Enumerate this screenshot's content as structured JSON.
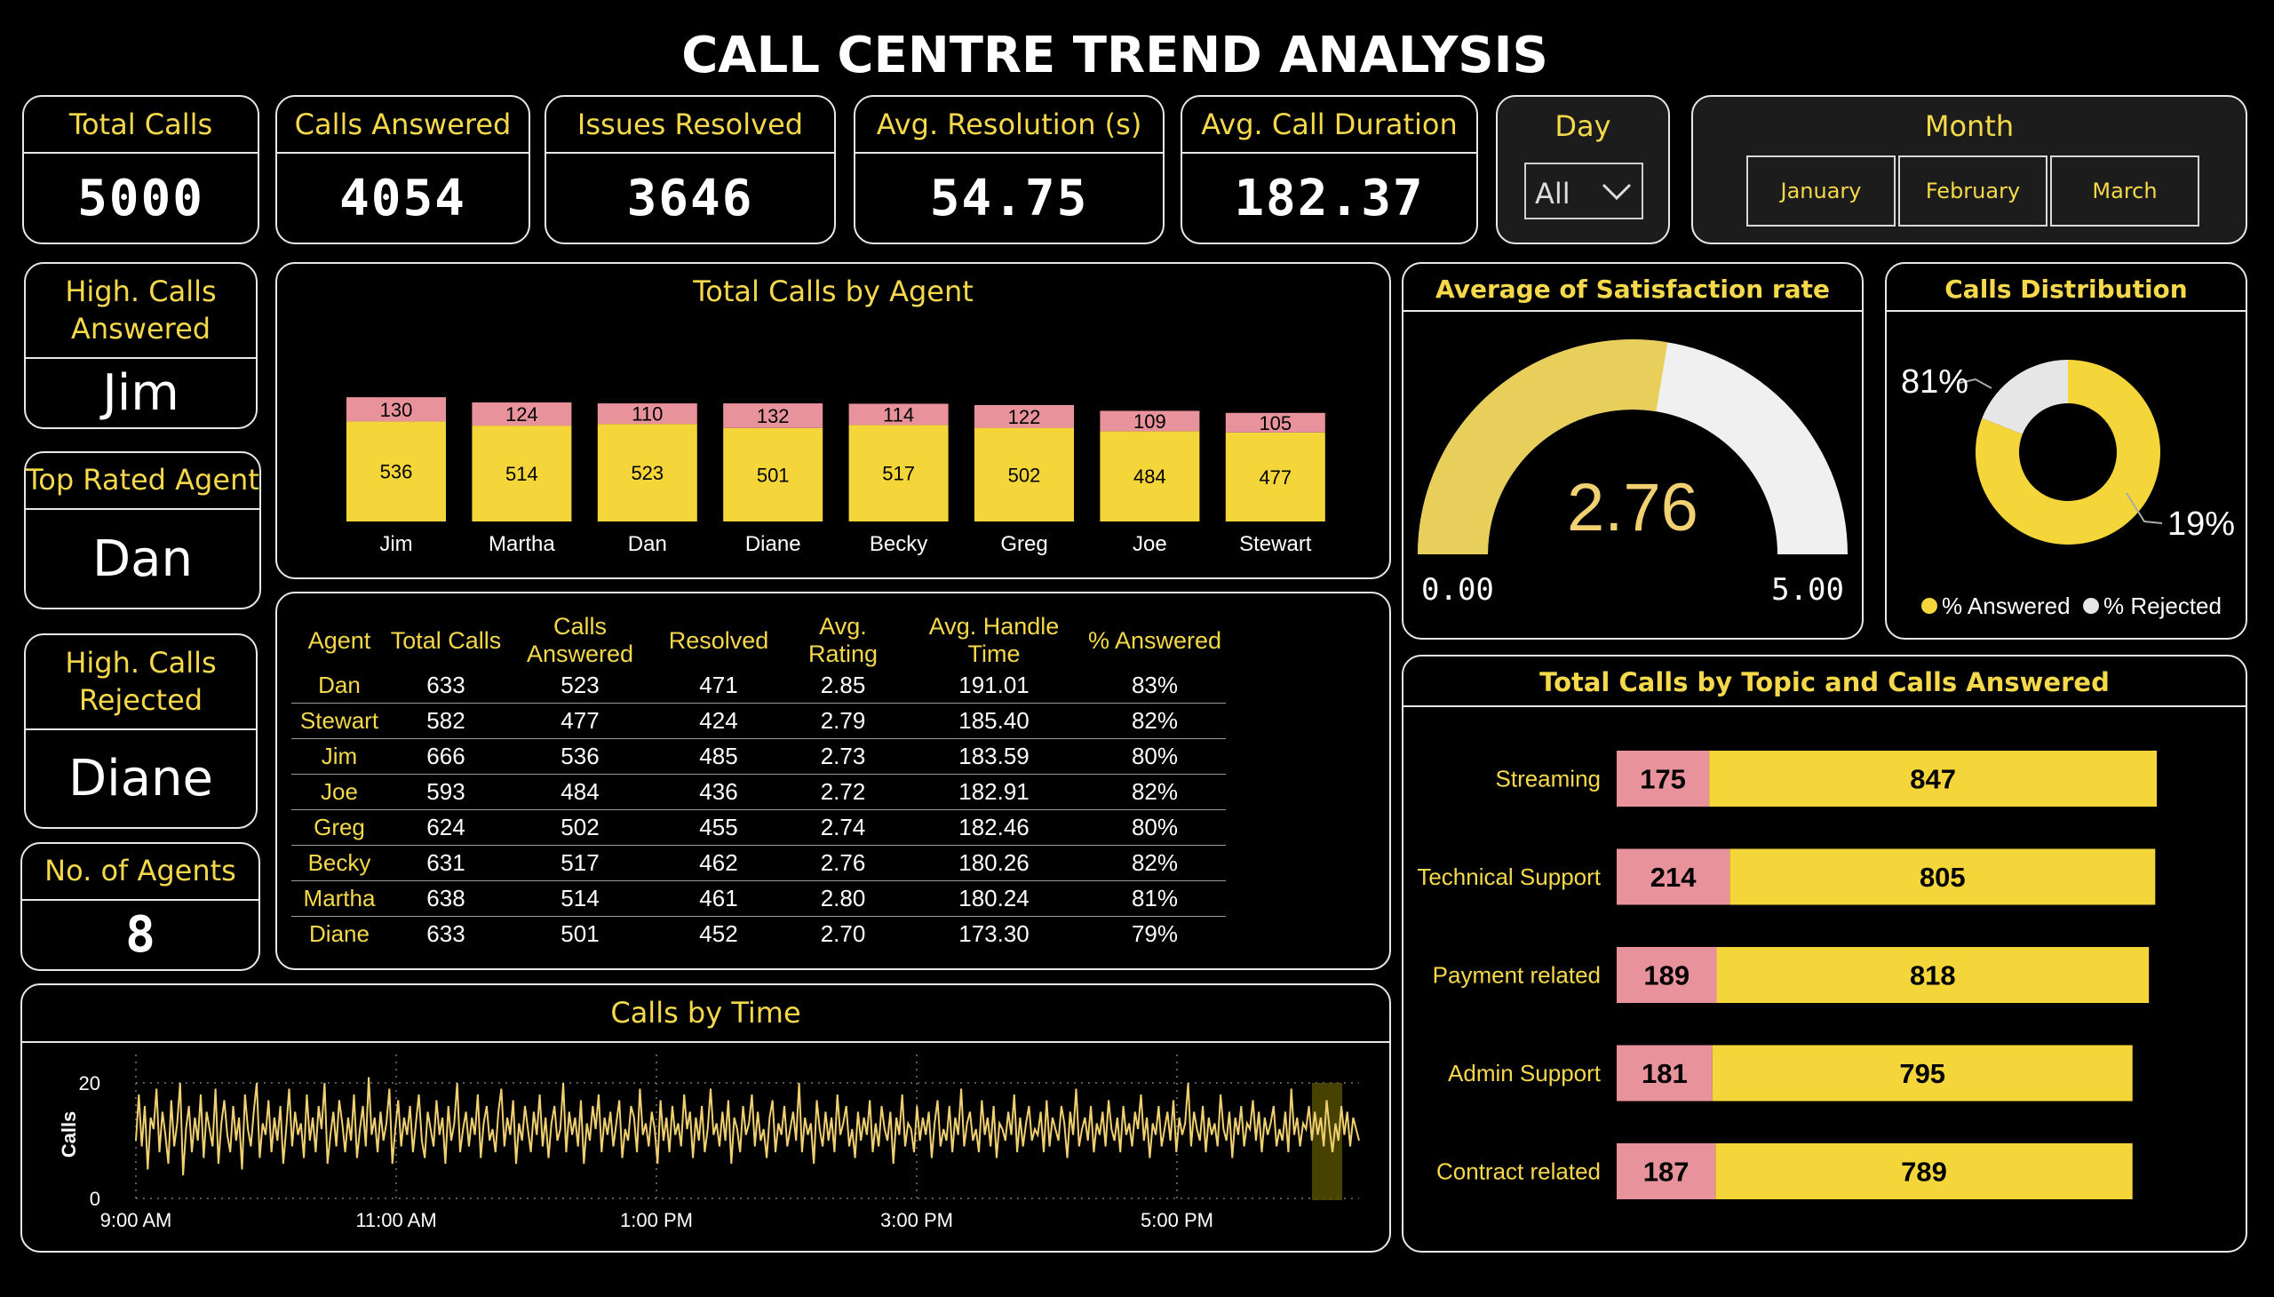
{
  "title": "CALL CENTRE TREND ANALYSIS",
  "kpis": {
    "total_calls": {
      "label": "Total Calls",
      "value": "5000"
    },
    "calls_answered": {
      "label": "Calls Answered",
      "value": "4054"
    },
    "issues_resolved": {
      "label": "Issues Resolved",
      "value": "3646"
    },
    "avg_resolution": {
      "label": "Avg. Resolution (s)",
      "value": "54.75"
    },
    "avg_call_duration": {
      "label": "Avg. Call Duration",
      "value": "182.37"
    }
  },
  "filters": {
    "day": {
      "label": "Day",
      "value": "All"
    },
    "month": {
      "label": "Month",
      "options": [
        "January",
        "February",
        "March"
      ]
    }
  },
  "side_cards": {
    "high_calls_answered": {
      "label": "High. Calls Answered",
      "value": "Jim"
    },
    "top_rated_agent": {
      "label": "Top Rated Agent",
      "value": "Dan"
    },
    "high_calls_rejected": {
      "label": "High. Calls Rejected",
      "value": "Diane"
    },
    "num_agents": {
      "label": "No. of Agents",
      "value": "8"
    }
  },
  "colors": {
    "yellow": "#f5d63a",
    "pink": "#e8929c",
    "gauge_fill": "#e8cf5c",
    "gauge_track": "#f0f0f0",
    "line": "#f0d070"
  },
  "table": {
    "headers": [
      "Agent",
      "Total Calls",
      "Calls Answered",
      "Resolved",
      "Avg. Rating",
      "Avg. Handle Time",
      "% Answered"
    ],
    "rows": [
      [
        "Dan",
        "633",
        "523",
        "471",
        "2.85",
        "191.01",
        "83%"
      ],
      [
        "Stewart",
        "582",
        "477",
        "424",
        "2.79",
        "185.40",
        "82%"
      ],
      [
        "Jim",
        "666",
        "536",
        "485",
        "2.73",
        "183.59",
        "80%"
      ],
      [
        "Joe",
        "593",
        "484",
        "436",
        "2.72",
        "182.91",
        "82%"
      ],
      [
        "Greg",
        "624",
        "502",
        "455",
        "2.74",
        "182.46",
        "80%"
      ],
      [
        "Becky",
        "631",
        "517",
        "462",
        "2.76",
        "180.26",
        "82%"
      ],
      [
        "Martha",
        "638",
        "514",
        "461",
        "2.80",
        "180.24",
        "81%"
      ],
      [
        "Diane",
        "633",
        "501",
        "452",
        "2.70",
        "173.30",
        "79%"
      ]
    ]
  },
  "chart_data": [
    {
      "type": "bar",
      "title": "Total Calls by Agent",
      "stacked": true,
      "categories": [
        "Jim",
        "Martha",
        "Dan",
        "Diane",
        "Becky",
        "Greg",
        "Joe",
        "Stewart"
      ],
      "series": [
        {
          "values": [
            536,
            514,
            523,
            501,
            517,
            502,
            484,
            477
          ],
          "color": "#f5d63a"
        },
        {
          "values": [
            130,
            124,
            110,
            132,
            114,
            122,
            109,
            105
          ],
          "color": "#e8929c"
        }
      ]
    },
    {
      "type": "gauge",
      "title": "Average of Satisfaction rate",
      "value": 2.76,
      "value_label": "2.76",
      "min": 0,
      "max": 5,
      "min_label": "0.00",
      "max_label": "5.00"
    },
    {
      "type": "pie",
      "title": "Calls Distribution",
      "donut": true,
      "slices": [
        {
          "name": "% Answered",
          "value": 81,
          "label": "81%",
          "color": "#f5d63a"
        },
        {
          "name": "% Rejected",
          "value": 19,
          "label": "19%",
          "color": "#e6e6e6"
        }
      ],
      "legend_position": "bottom"
    },
    {
      "type": "bar",
      "title": "Total Calls by Topic and Calls Answered",
      "orientation": "horizontal",
      "stacked": true,
      "categories": [
        "Streaming",
        "Technical Support",
        "Payment related",
        "Admin Support",
        "Contract related"
      ],
      "series": [
        {
          "values": [
            175,
            214,
            189,
            181,
            187
          ],
          "color": "#e8929c"
        },
        {
          "values": [
            847,
            805,
            818,
            795,
            789
          ],
          "color": "#f5d63a"
        }
      ]
    },
    {
      "type": "line",
      "title": "Calls by Time",
      "ylabel": "Calls",
      "x_ticks": [
        "9:00 AM",
        "11:00 AM",
        "1:00 PM",
        "3:00 PM",
        "5:00 PM"
      ],
      "y_ticks": [
        "0",
        "20"
      ],
      "ylim": [
        0,
        24
      ],
      "grid": true,
      "values": [
        10,
        18,
        9,
        16,
        5,
        14,
        12,
        19,
        8,
        15,
        11,
        6,
        17,
        9,
        13,
        20,
        4,
        12,
        16,
        8,
        14,
        10,
        18,
        7,
        15,
        12,
        9,
        19,
        6,
        13,
        17,
        11,
        8,
        16,
        10,
        14,
        5,
        18,
        12,
        9,
        15,
        20,
        7,
        13,
        11,
        17,
        8,
        14,
        10,
        16,
        6,
        12,
        19,
        9,
        15,
        11,
        13,
        7,
        18,
        10,
        14,
        8,
        16,
        12,
        20,
        6,
        11,
        15,
        9,
        17,
        13,
        8,
        14,
        10,
        18,
        7,
        12,
        16,
        9,
        21,
        11,
        14,
        8,
        15,
        10,
        13,
        19,
        6,
        12,
        17,
        9,
        14,
        11,
        16,
        8,
        13,
        18,
        10,
        7,
        15,
        12,
        9,
        17,
        11,
        14,
        6,
        16,
        10,
        13,
        20,
        8,
        12,
        15,
        9,
        14,
        11,
        18,
        7,
        13,
        16,
        10,
        12,
        8,
        15,
        19,
        9,
        14,
        11,
        17,
        6,
        13,
        10,
        16,
        12,
        8,
        15,
        11,
        18,
        9,
        14,
        7,
        13,
        16,
        10,
        12,
        20,
        8,
        15,
        11,
        14,
        9,
        17,
        6,
        13,
        10,
        16,
        12,
        18,
        8,
        14,
        11,
        15,
        9,
        13,
        17,
        7,
        12,
        10,
        16,
        14,
        8,
        19,
        11,
        13,
        9,
        15,
        12,
        6,
        17,
        10,
        14,
        8,
        16,
        11,
        13,
        9,
        18,
        12,
        15,
        7,
        14,
        10,
        16,
        8,
        12,
        19,
        11,
        13,
        9,
        15,
        10,
        17,
        6,
        14,
        12,
        8,
        16,
        11,
        13,
        18,
        9,
        15,
        10,
        12,
        7,
        14,
        17,
        8,
        13,
        11,
        16,
        9,
        12,
        15,
        10,
        20,
        8,
        14,
        11,
        13,
        6,
        17,
        12,
        9,
        15,
        10,
        14,
        8,
        18,
        11,
        13,
        16,
        9,
        12,
        7,
        15,
        10,
        14,
        11,
        17,
        8,
        13,
        9,
        16,
        12,
        10,
        15,
        6,
        14,
        11,
        18,
        9,
        13,
        12,
        8,
        16,
        10,
        14,
        11,
        15,
        7,
        13,
        17,
        9,
        12,
        10,
        16,
        8,
        14,
        11,
        19,
        9,
        13,
        15,
        10,
        12,
        8,
        17,
        11,
        14,
        9,
        16,
        7,
        13,
        12,
        10,
        15,
        11,
        18,
        8,
        14,
        9,
        13,
        16,
        10,
        12,
        11,
        15,
        8,
        17,
        9,
        14,
        12,
        10,
        16,
        13,
        7,
        15,
        11,
        19,
        9,
        12,
        14,
        10,
        16,
        8,
        13,
        11,
        15,
        9,
        17,
        12,
        10,
        14,
        8,
        16,
        11,
        13,
        9,
        15,
        12,
        18,
        10,
        14,
        7,
        13,
        11,
        16,
        9,
        12,
        15,
        10,
        17,
        8,
        14,
        11,
        13,
        20,
        9,
        15,
        12,
        10,
        16,
        8,
        14,
        11,
        13,
        9,
        18,
        12,
        10,
        15,
        7,
        14,
        11,
        16,
        9,
        13,
        12,
        17,
        10,
        15,
        8,
        14,
        11,
        13,
        16,
        9,
        12,
        10,
        15,
        8,
        19,
        11,
        14,
        9,
        13,
        12,
        16,
        10,
        15,
        11,
        14,
        9,
        17,
        12,
        8,
        13,
        10,
        16,
        11,
        15,
        9,
        14,
        12,
        10
      ]
    }
  ]
}
